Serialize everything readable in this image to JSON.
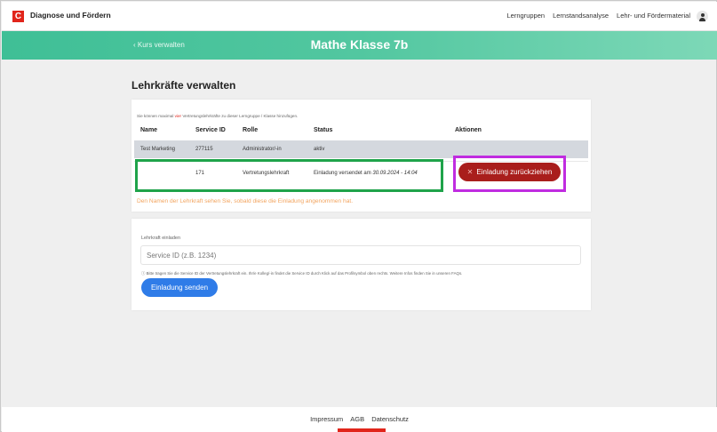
{
  "topbar": {
    "logo_letter": "C",
    "app_title": "Diagnose und Fördern",
    "nav": [
      "Lerngruppen",
      "Lernstandsanalyse",
      "Lehr- und Fördermaterial"
    ]
  },
  "header": {
    "back_label": "Kurs verwalten",
    "course_title": "Mathe Klasse 7b"
  },
  "page_title": "Lehrkräfte verwalten",
  "teachers": {
    "hint_before": "Sie können maximal ",
    "hint_highlight": "vier",
    "hint_after": " Vertretungslehrkräfte zu dieser Lerngruppe / Klasse hinzufügen.",
    "columns": [
      "Name",
      "Service ID",
      "Rolle",
      "Status",
      "Aktionen"
    ],
    "rows": [
      {
        "name": "Test Marketing",
        "service_id": "277115",
        "role": "Administrator/-in",
        "status": "aktiv"
      },
      {
        "name": "",
        "service_id": "171",
        "role": "Vertretungslehrkraft",
        "status_prefix": "Einladung versendet am ",
        "status_date": "30.09.2024 - 14:04",
        "action": "Einladung zurückziehen"
      }
    ],
    "name_note": "Den Namen der Lehrkraft sehen Sie, sobald diese die Einladung angenommen hat."
  },
  "invite": {
    "label": "Lehrkraft einladen",
    "placeholder": "Service ID (z.B. 1234)",
    "info": "Bitte tragen Sie die Service ID der Vertretungslehrkraft ein. Ihr/e Kolleg/-in findet die Service ID durch Klick auf das Profilsymbol oben rechts. Weitere Infos finden Sie in unseren FAQs.",
    "send_label": "Einladung senden"
  },
  "footer": {
    "links": [
      "Impressum",
      "AGB",
      "Datenschutz"
    ]
  },
  "colors": {
    "brand_red": "#e1251b",
    "header_green": "#3fbf96",
    "revoke_red": "#a91e1c",
    "send_blue": "#2f7ce8"
  }
}
